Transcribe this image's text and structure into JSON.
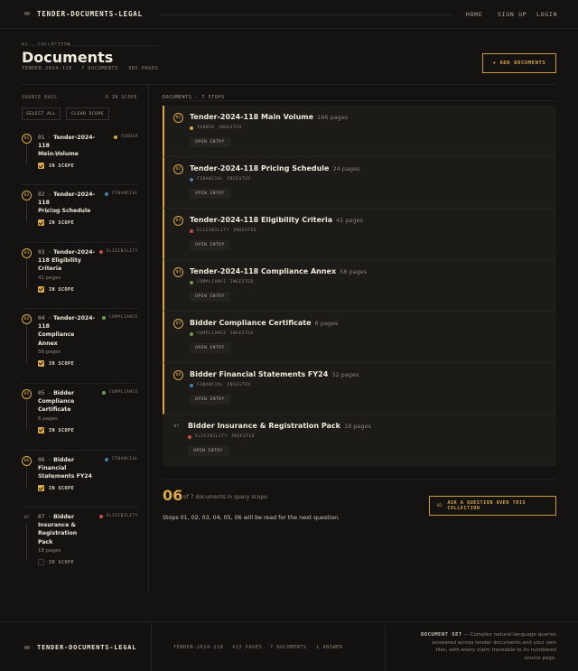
{
  "brand": {
    "num": "00",
    "name": "TENDER-DOCUMENTS-LEGAL"
  },
  "nav": [
    "HOME",
    "SIGN UP",
    "LOGIN"
  ],
  "header": {
    "kicker": "01 · COLLECTION",
    "title": "Documents",
    "meta": [
      "TENDER-2024-118",
      "7 DOCUMENTS",
      "365 PAGES"
    ],
    "add_button": "+ ADD DOCUMENTS"
  },
  "rail": {
    "label": "SOURCE RAIL",
    "count": "6 IN SCOPE",
    "select_all": "SELECT ALL",
    "clear_scope": "CLEAR SCOPE",
    "scope_label": "IN SCOPE"
  },
  "colors": {
    "accent": "#d9a848",
    "tender": "#d9a848",
    "financial": "#4a7fa8",
    "eligibility": "#c2503e",
    "compliance": "#6e9a4e"
  },
  "documents": [
    {
      "num": "01",
      "n": "01 ·",
      "title": "Tender-2024-118 Main Volume",
      "rail_lines": [
        "Tender-2024-118",
        "Main Volume"
      ],
      "pages": "186 pages",
      "category": "TENDER",
      "status": "INGESTED",
      "in_scope": true
    },
    {
      "num": "02",
      "n": "02 ·",
      "title": "Tender-2024-118 Pricing Schedule",
      "rail_lines": [
        "Tender-2024-118",
        "Pricing Schedule"
      ],
      "pages": "24 pages",
      "category": "FINANCIAL",
      "status": "INGESTED",
      "in_scope": true
    },
    {
      "num": "03",
      "n": "03 ·",
      "title": "Tender-2024-118 Eligibility Criteria",
      "rail_lines": [
        "Tender-2024-",
        "118 Eligibility",
        "Criteria"
      ],
      "pages": "41 pages",
      "category": "ELIGIBILITY",
      "status": "INGESTED",
      "in_scope": true
    },
    {
      "num": "04",
      "n": "04 ·",
      "title": "Tender-2024-118 Compliance Annex",
      "rail_lines": [
        "Tender-2024-",
        "118",
        "Compliance",
        "Annex"
      ],
      "pages": "58 pages",
      "category": "COMPLIANCE",
      "status": "INGESTED",
      "in_scope": true
    },
    {
      "num": "05",
      "n": "05 ·",
      "title": "Bidder Compliance Certificate",
      "rail_lines": [
        "Bidder",
        "Compliance",
        "Certificate"
      ],
      "pages": "6 pages",
      "category": "COMPLIANCE",
      "status": "INGESTED",
      "in_scope": true
    },
    {
      "num": "06",
      "n": "06 ·",
      "title": "Bidder Financial Statements FY24",
      "rail_lines": [
        "Bidder Financial",
        "Statements FY24"
      ],
      "pages": "32 pages",
      "category": "FINANCIAL",
      "status": "INGESTED",
      "in_scope": true
    },
    {
      "num": "07",
      "n": "07 ·",
      "title": "Bidder Insurance & Registration Pack",
      "rail_lines": [
        "Bidder",
        "Insurance &",
        "Registration",
        "Pack"
      ],
      "pages": "18 pages",
      "category": "ELIGIBILITY",
      "status": "INGESTED",
      "in_scope": false
    }
  ],
  "docs_head": "DOCUMENTS · 7 STOPS",
  "open_entry": "OPEN ENTRY",
  "summary": {
    "count": "06",
    "of_text": "of 7 documents in query scope",
    "note": "Stops 01, 02, 03, 04, 05, 06 will be read for the next question.",
    "ask_num": "02",
    "ask_label_1": "ASK A QUESTION OVER THIS",
    "ask_label_2": "COLLECTION"
  },
  "footer": {
    "brand_num": "00",
    "brand": "TENDER-DOCUMENTS-LEGAL",
    "meta": [
      "TENDER-2024-118",
      "412 PAGES",
      "7 DOCUMENTS",
      "1 ANSWER"
    ],
    "note_label": "DOCUMENT SET",
    "note_lines": [
      "— Complex natural-language queries",
      "answered across tender documents and your own",
      "files, with every claim traceable to its numbered",
      "source page."
    ]
  }
}
